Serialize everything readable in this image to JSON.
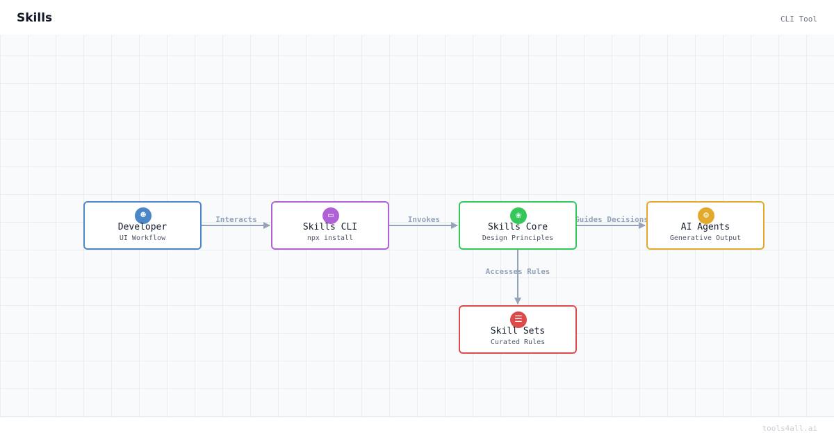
{
  "header": {
    "title": "Skills",
    "tag": "CLI Tool"
  },
  "footer": {
    "watermark": "tools4all.ai"
  },
  "diagram": {
    "nodes": {
      "developer": {
        "title": "Developer",
        "subtitle": "UI Workflow",
        "icon": "developer-icon",
        "color": "#4a86c8"
      },
      "skills_cli": {
        "title": "Skills CLI",
        "subtitle": "npx install",
        "icon": "laptop-icon",
        "color": "#b061d6"
      },
      "skills_core": {
        "title": "Skills Core",
        "subtitle": "Design Principles",
        "icon": "brain-icon",
        "color": "#34c759"
      },
      "ai_agents": {
        "title": "AI Agents",
        "subtitle": "Generative Output",
        "icon": "robot-icon",
        "color": "#e3a92b"
      },
      "skill_sets": {
        "title": "Skill Sets",
        "subtitle": "Curated Rules",
        "icon": "books-icon",
        "color": "#dc4a4a"
      }
    },
    "edges": [
      {
        "from": "developer",
        "to": "skills_cli",
        "label": "Interacts"
      },
      {
        "from": "skills_cli",
        "to": "skills_core",
        "label": "Invokes"
      },
      {
        "from": "skills_core",
        "to": "ai_agents",
        "label": "Guides Decisions"
      },
      {
        "from": "skills_core",
        "to": "skill_sets",
        "label": "Accesses Rules"
      }
    ]
  }
}
